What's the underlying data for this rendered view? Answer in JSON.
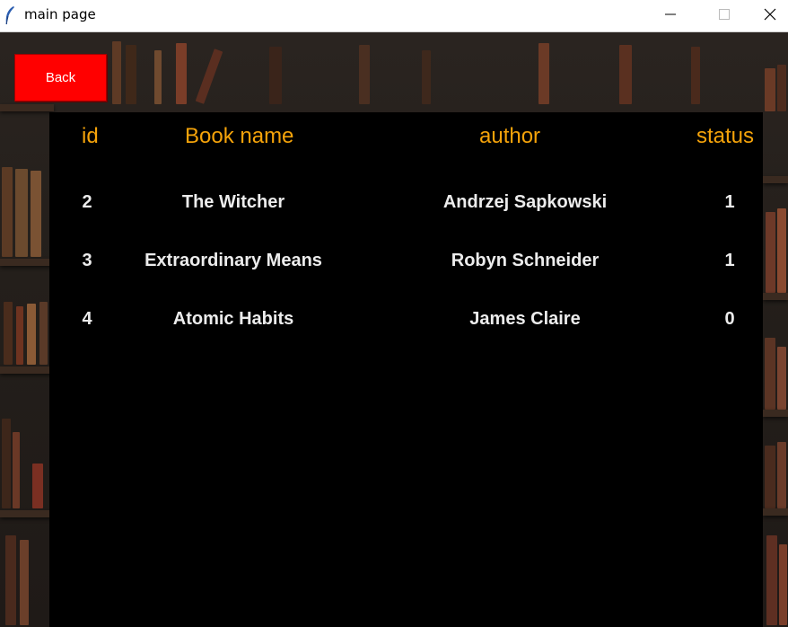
{
  "window": {
    "title": "main page",
    "minimize_icon": "minimize-icon",
    "maximize_icon": "maximize-icon",
    "close_icon": "close-icon",
    "app_icon": "feather-icon"
  },
  "back_button": {
    "label": "Back",
    "color": "#ff0000"
  },
  "table": {
    "header_color": "#f5a30a",
    "headers": {
      "id": "id",
      "name": "Book name",
      "author": "author",
      "status": "status"
    },
    "rows": [
      {
        "id": "2",
        "name": "The Witcher",
        "author": "Andrzej Sapkowski",
        "status": "1"
      },
      {
        "id": "3",
        "name": "Extraordinary Means",
        "author": "Robyn Schneider",
        "status": "1"
      },
      {
        "id": "4",
        "name": "Atomic Habits",
        "author": "James Claire",
        "status": "0"
      }
    ]
  }
}
